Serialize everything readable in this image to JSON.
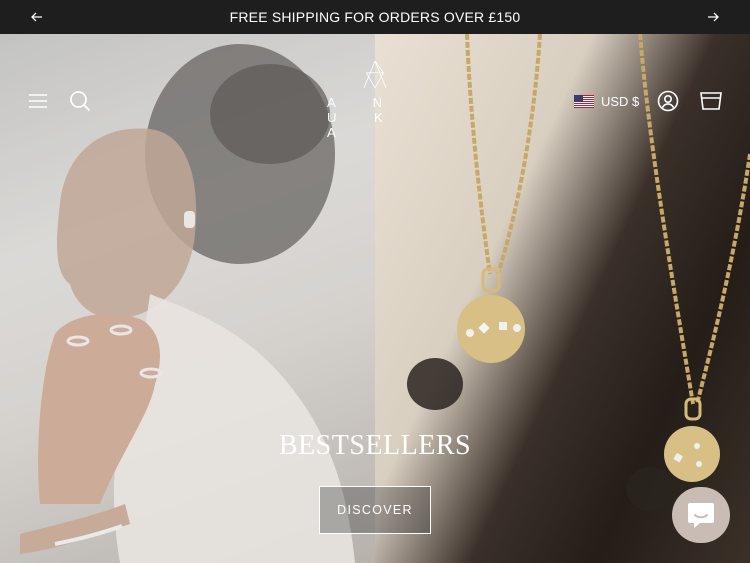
{
  "announcement": {
    "text": "FREE SHIPPING FOR ORDERS OVER £150",
    "prev_icon": "arrow-left-icon",
    "next_icon": "arrow-right-icon"
  },
  "header": {
    "logo_text": "A N U K A",
    "currency_label": "USD $",
    "menu_icon": "hamburger-menu-icon",
    "search_icon": "search-icon",
    "account_icon": "account-icon",
    "cart_icon": "cart-icon",
    "flag_icon": "us-flag-icon"
  },
  "hero": {
    "title": "BESTSELLERS",
    "cta_label": "DISCOVER"
  },
  "chat": {
    "icon": "chat-bubble-icon"
  }
}
